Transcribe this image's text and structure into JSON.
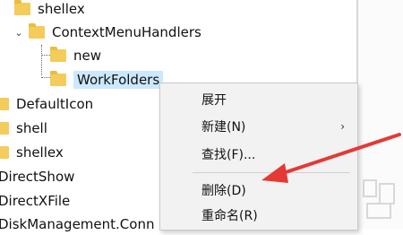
{
  "tree": {
    "items": [
      {
        "label": "shellex",
        "indent": "level3",
        "expanded": false
      },
      {
        "label": "ContextMenuHandlers",
        "indent": "level4",
        "expanded": true
      },
      {
        "label": "new",
        "indent": "level5"
      },
      {
        "label": "WorkFolders",
        "indent": "level5",
        "selected": true
      },
      {
        "label": "DefaultIcon",
        "indent": "level2"
      },
      {
        "label": "shell",
        "indent": "level2"
      },
      {
        "label": "shellex",
        "indent": "level2"
      },
      {
        "label": "DirectShow",
        "indent": "level1"
      },
      {
        "label": "DirectXFile",
        "indent": "level1"
      },
      {
        "label": "DiskManagement.Conn",
        "indent": "level1"
      }
    ]
  },
  "context_menu": {
    "items": [
      {
        "label": "展开"
      },
      {
        "label": "新建(N)",
        "has_submenu": true
      },
      {
        "label": "查找(F)..."
      },
      {
        "label": "删除(D)"
      },
      {
        "label": "重命名(R)"
      }
    ]
  },
  "colors": {
    "folder": "#f3cc5c",
    "selection": "#cce8ff",
    "arrow": "#e53935"
  },
  "icons": {
    "folder": "folder-icon",
    "expand": "chevron-down-icon",
    "submenu": "chevron-right-icon",
    "annotation": "red-arrow-icon"
  }
}
